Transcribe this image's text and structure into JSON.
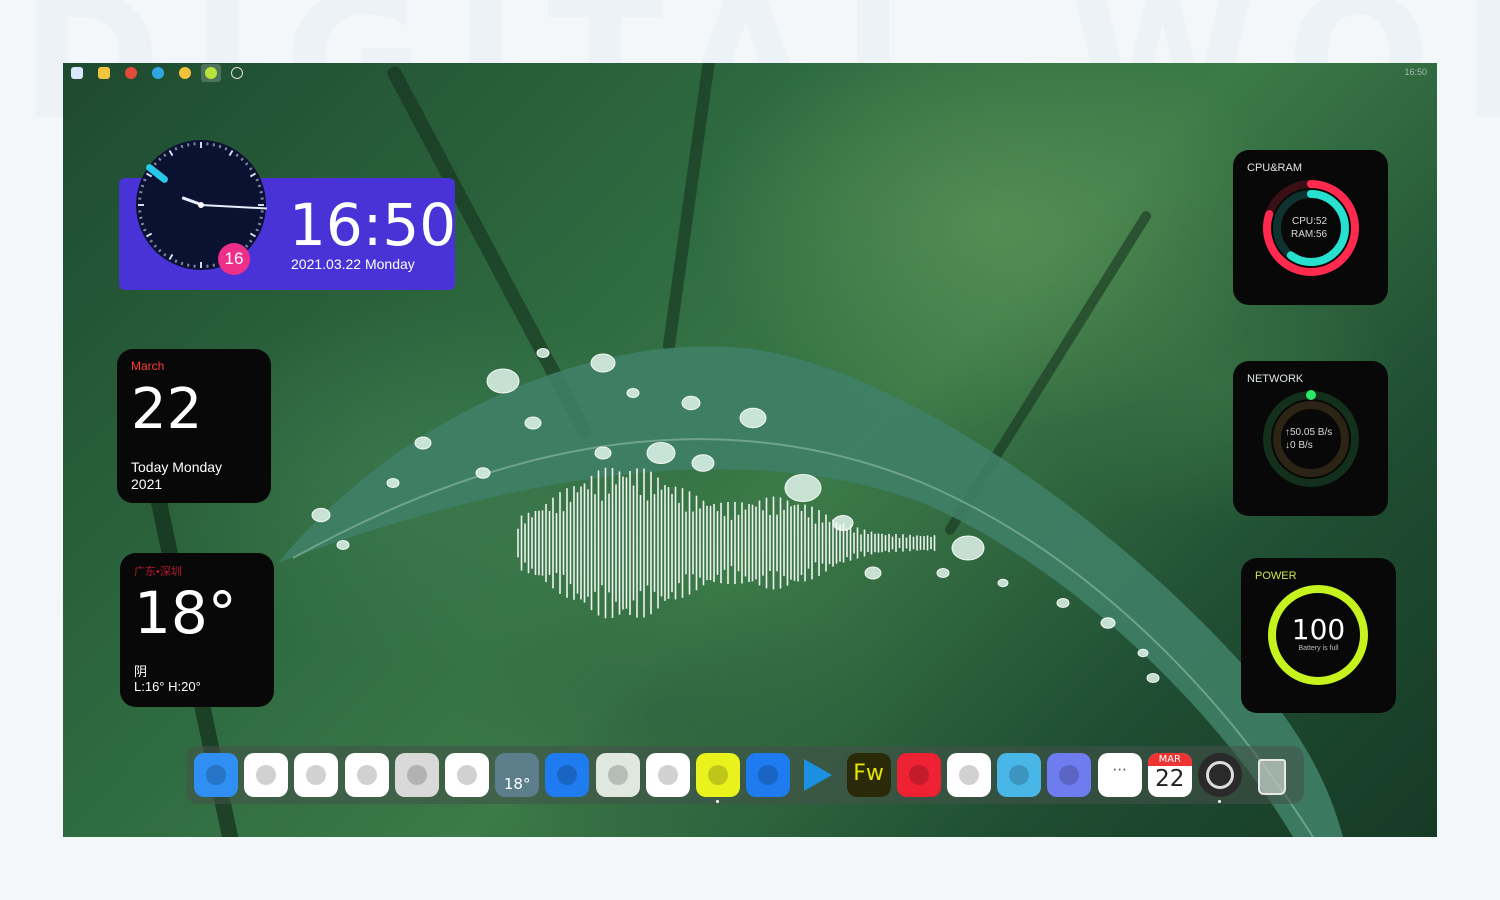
{
  "taskbar": {
    "icons": [
      "windows-start-icon",
      "file-explorer-icon",
      "chrome-icon",
      "edge-icon",
      "chrome-icon",
      "android-icon",
      "settings-icon"
    ],
    "time": "16:50"
  },
  "clock_widget": {
    "time": "16:50",
    "date_line": "2021.03.22 Monday",
    "day_badge": "16"
  },
  "calendar_widget": {
    "month": "March",
    "day": "22",
    "line1": "Today Monday",
    "line2": "2021"
  },
  "weather_widget": {
    "city": "广东•深圳",
    "temp": "18°",
    "condition": "阴",
    "range": "L:16° H:20°"
  },
  "cpu_widget": {
    "title": "CPU&RAM",
    "cpu": "CPU:52",
    "ram": "RAM:56",
    "cpu_value": 52,
    "ram_value": 56,
    "colors": {
      "cpu": "#ff2a4d",
      "ram": "#28e0d0"
    }
  },
  "network_widget": {
    "title": "NETWORK",
    "upload": "↑50.05 B/s",
    "download": "↓0 B/s",
    "color": "#2ee86a"
  },
  "power_widget": {
    "title": "POWER",
    "value": "100",
    "label": "Battery is full",
    "level": 100,
    "color": "#c6f21e"
  },
  "dock": {
    "items": [
      {
        "name": "finder",
        "icon": "finder-icon",
        "bg": "#2f8ff2"
      },
      {
        "name": "home",
        "icon": "home-icon",
        "bg": "#ffffff"
      },
      {
        "name": "launchpad",
        "icon": "launchpad-icon",
        "bg": "#ffffff"
      },
      {
        "name": "power-orb",
        "icon": "orange-circle-icon",
        "bg": "#ffffff"
      },
      {
        "name": "calculator",
        "icon": "calculator-icon",
        "bg": "#d9d9d9"
      },
      {
        "name": "photos",
        "icon": "photos-icon",
        "bg": "#ffffff"
      },
      {
        "name": "weather",
        "icon": "weather-icon",
        "bg": "#5c7d8a",
        "text": "18°"
      },
      {
        "name": "pencil-app",
        "icon": "pencil-icon",
        "bg": "#1e7cf0"
      },
      {
        "name": "wechat",
        "icon": "wechat-icon",
        "bg": "#dfe7df"
      },
      {
        "name": "qq",
        "icon": "qq-penguin-icon",
        "bg": "#ffffff"
      },
      {
        "name": "music",
        "icon": "music-icon",
        "bg": "#eaf21e"
      },
      {
        "name": "pencil-app-2",
        "icon": "pencil-icon",
        "bg": "#1e7cf0"
      },
      {
        "name": "vscode",
        "icon": "vscode-icon",
        "bg": "transparent"
      },
      {
        "name": "fireworks",
        "icon": "fireworks-icon",
        "bg": "#2a2a08",
        "text": "Fw"
      },
      {
        "name": "xmind",
        "icon": "xmind-icon",
        "bg": "#ee2233"
      },
      {
        "name": "screenshot",
        "icon": "screenshot-icon",
        "bg": "#ffffff"
      },
      {
        "name": "color-picker",
        "icon": "color-tools-icon",
        "bg": "#49b6e8"
      },
      {
        "name": "volume",
        "icon": "volume-icon",
        "bg": "#6e7cf0"
      },
      {
        "name": "more",
        "icon": "more-icon",
        "bg": "#ffffff",
        "text": "···"
      },
      {
        "name": "calendar",
        "icon": "calendar-icon",
        "bg": "#ffffff",
        "month": "MAR",
        "day": "22"
      },
      {
        "name": "obs",
        "icon": "obs-icon",
        "bg": "#2a2a2a"
      },
      {
        "name": "trash",
        "icon": "trash-icon",
        "bg": "transparent"
      }
    ]
  }
}
